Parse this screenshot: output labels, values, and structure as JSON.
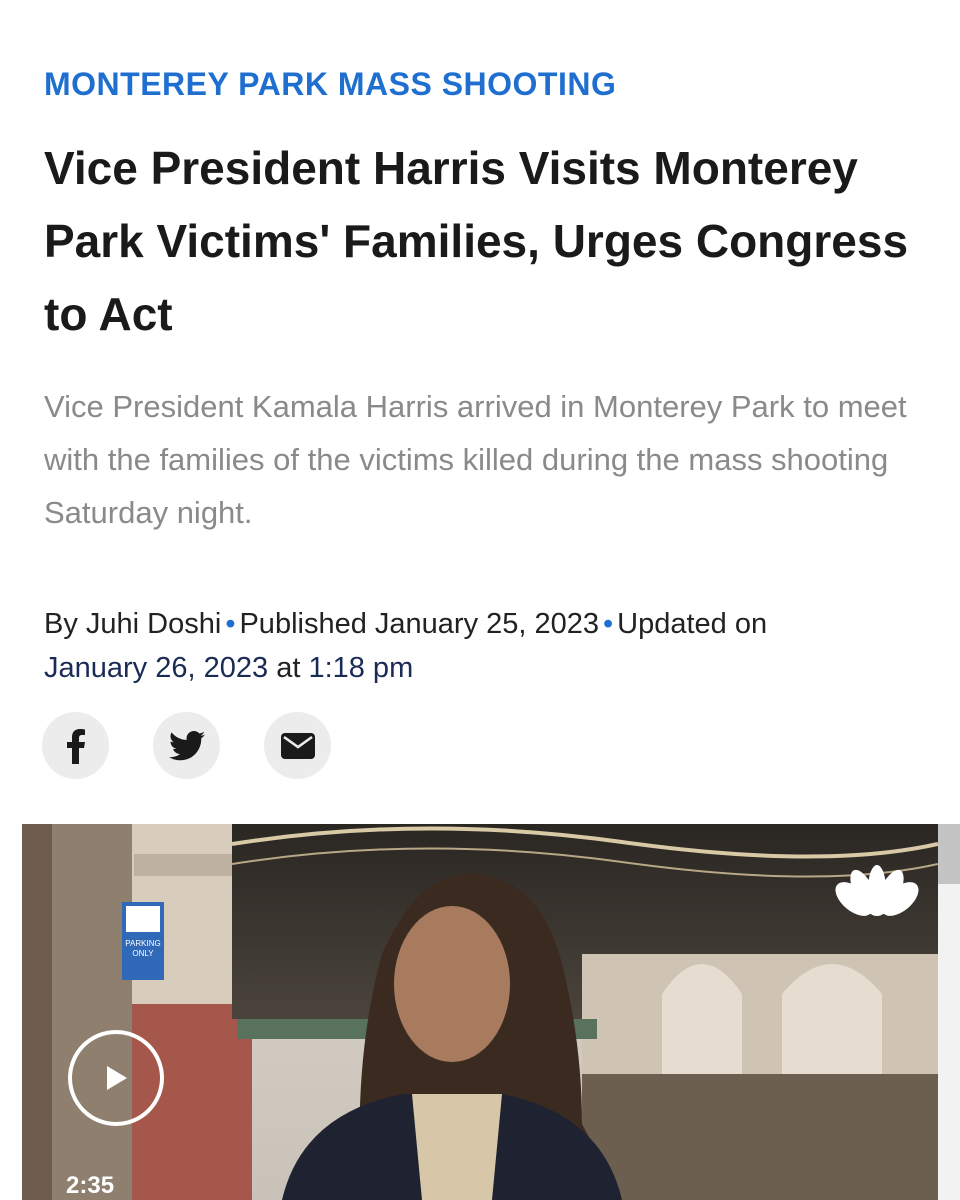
{
  "article": {
    "kicker": "MONTEREY PARK MASS SHOOTING",
    "headline": "Vice President Harris Visits Monterey Park Victims' Families, Urges Congress to Act",
    "dek": "Vice President Kamala Harris arrived in Monterey Park to meet with the families of the victims killed during the mass shooting Saturday night.",
    "byline": {
      "author": "By Juhi Doshi",
      "separator": "•",
      "published": "Published January 25, 2023",
      "updated_prefix": "Updated on",
      "updated_date": "January 26, 2023",
      "updated_at": "at",
      "updated_time": "1:18 pm"
    }
  },
  "share": {
    "buttons": [
      {
        "icon": "facebook-icon"
      },
      {
        "icon": "twitter-icon"
      },
      {
        "icon": "email-icon"
      }
    ]
  },
  "video": {
    "duration": "2:35",
    "signs": {
      "parking_line1": "PARKING",
      "parking_line2": "ONLY"
    }
  },
  "colors": {
    "kicker": "#1f6fd0",
    "headline": "#1a1a1a",
    "dek": "#8a8a8a",
    "link_date": "#1a2b55",
    "share_bg": "#ececec"
  }
}
